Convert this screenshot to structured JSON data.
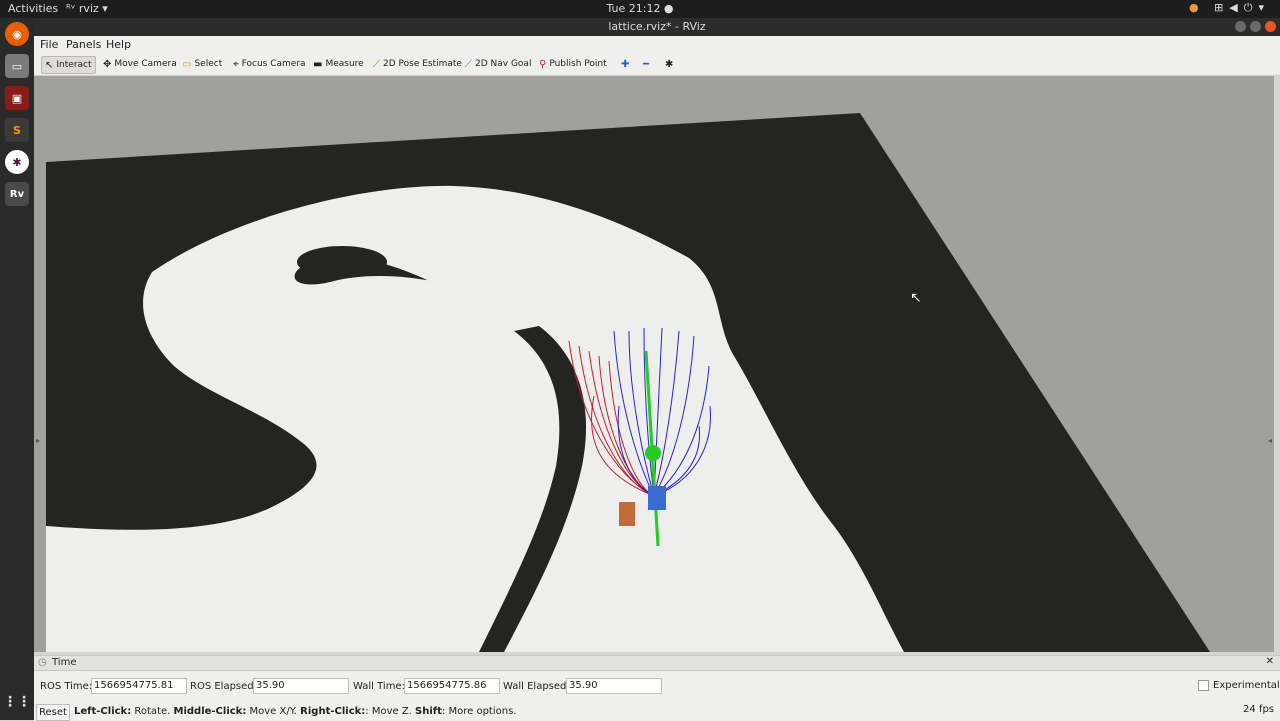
{
  "topbar": {
    "activities": "Activities",
    "app_menu": "rviz",
    "clock": "Tue 21:12 ●"
  },
  "window": {
    "title": "lattice.rviz* - RViz"
  },
  "menu": {
    "file": "File",
    "panels": "Panels",
    "help": "Help"
  },
  "toolbar": {
    "interact": "Interact",
    "move_camera": "Move Camera",
    "select": "Select",
    "focus_camera": "Focus Camera",
    "measure": "Measure",
    "pose_estimate": "2D Pose Estimate",
    "nav_goal": "2D Nav Goal",
    "publish_point": "Publish Point"
  },
  "time_panel": {
    "title": "Time",
    "ros_time_label": "ROS Time:",
    "ros_time": "1566954775.81",
    "ros_elapsed_label": "ROS Elapsed:",
    "ros_elapsed": "35.90",
    "wall_time_label": "Wall Time:",
    "wall_time": "1566954775.86",
    "wall_elapsed_label": "Wall Elapsed:",
    "wall_elapsed": "35.90",
    "experimental": "Experimental"
  },
  "status": {
    "reset": "Reset",
    "left_click": "Left-Click:",
    "left_click_text": " Rotate. ",
    "middle_click": "Middle-Click:",
    "middle_click_text": " Move X/Y. ",
    "right_click": "Right-Click:",
    "right_click_text": ": Move Z. ",
    "shift": "Shift",
    "shift_text": ": More options.",
    "fps": "24 fps"
  },
  "colors": {
    "map_free": "#eeeeec",
    "map_occupied": "#222220",
    "background": "#a0a09e",
    "path_blue": "#2626cc",
    "path_red": "#c42030",
    "robot_green": "#22cc22"
  },
  "icons": [
    "firefox-icon",
    "files-icon",
    "terminal-icon",
    "sublime-icon",
    "slack-icon",
    "rviz-icon",
    "apps-grid-icon"
  ]
}
